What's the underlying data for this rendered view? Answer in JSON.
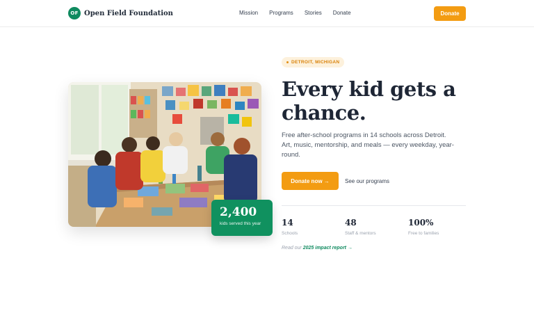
{
  "brand": {
    "logo_initials": "OF",
    "name": "Open Field Foundation"
  },
  "nav": {
    "items": [
      "Mission",
      "Programs",
      "Stories",
      "Donate"
    ]
  },
  "header": {
    "donate_label": "Donate"
  },
  "hero": {
    "location_pill": "DETROIT, MICHIGAN",
    "headline": "Every kid gets a chance.",
    "lede": "Free after-school programs in 14 schools across Detroit. Art, music, mentorship, and meals — every weekday, year-round.",
    "donate_cta": "Donate now →",
    "programs_link": "See our programs"
  },
  "badge": {
    "value": "2,400",
    "caption": "kids served this year"
  },
  "stats": [
    {
      "value": "14",
      "label": "Schools"
    },
    {
      "value": "48",
      "label": "Staff & mentors"
    },
    {
      "value": "100%",
      "label": "Free to families"
    }
  ],
  "report": {
    "prefix": "Read our",
    "link": "2025 impact report →"
  },
  "colors": {
    "accent": "#f39c12",
    "brand_green": "#10915f",
    "ink": "#1e2635"
  }
}
